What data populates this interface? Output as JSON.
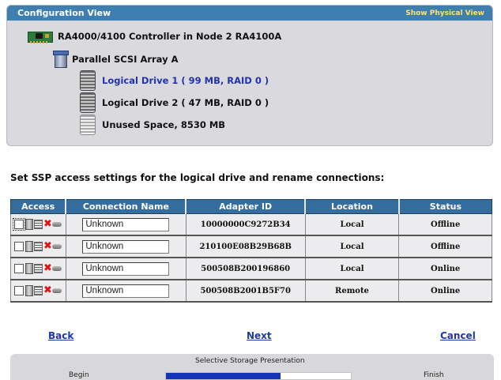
{
  "config_view": {
    "title": "Configuration View",
    "show_physical_label": "Show Physical View",
    "controller_label": "RA4000/4100 Controller in Node 2 RA4100A",
    "array_label": "Parallel SCSI Array A",
    "drives": [
      {
        "label": "Logical Drive 1 ( 99 MB, RAID 0 )",
        "icon": "disk-icon"
      },
      {
        "label": "Logical Drive 2 ( 47 MB, RAID 0 )",
        "icon": "disk-icon"
      },
      {
        "label": "Unused Space, 8530 MB",
        "icon": "unused-disk-icon"
      }
    ]
  },
  "instruction": "Set SSP access settings for the logical drive and rename connections:",
  "table": {
    "headers": [
      "Access",
      "Connection Name",
      "Adapter ID",
      "Location",
      "Status"
    ],
    "rows": [
      {
        "access_checked": false,
        "connection_name": "Unknown",
        "adapter_id": "10000000C9272B34",
        "location": "Local",
        "status": "Offline"
      },
      {
        "access_checked": false,
        "connection_name": "Unknown",
        "adapter_id": "210100E08B29B68B",
        "location": "Local",
        "status": "Offline"
      },
      {
        "access_checked": false,
        "connection_name": "Unknown",
        "adapter_id": "500508B200196860",
        "location": "Local",
        "status": "Online"
      },
      {
        "access_checked": false,
        "connection_name": "Unknown",
        "adapter_id": "500508B2001B5F70",
        "location": "Remote",
        "status": "Online"
      }
    ]
  },
  "nav": {
    "back": "Back",
    "next": "Next",
    "cancel": "Cancel"
  },
  "progress": {
    "title": "Selective Storage Presentation",
    "begin": "Begin",
    "finish": "Finish",
    "fraction": 0.62
  },
  "colors": {
    "header_blue": "#3f7fb0",
    "table_header_blue": "#356d9e",
    "link_blue": "#1a3aa5",
    "progress_fill": "#1533b8",
    "x_red": "#e01010"
  }
}
